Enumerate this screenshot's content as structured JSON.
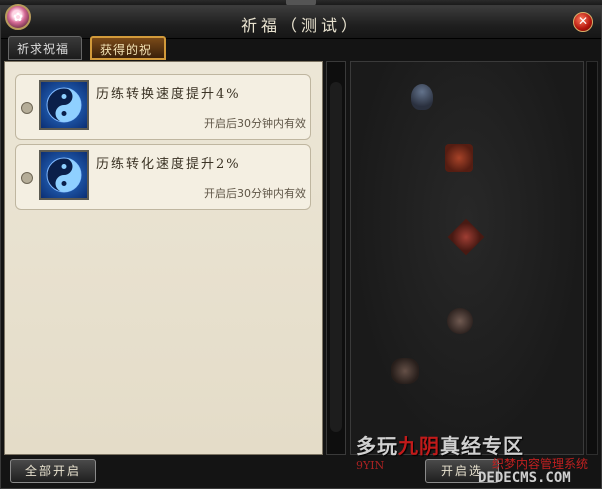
{
  "window": {
    "title": "祈福（测试）",
    "close_glyph": "✕"
  },
  "tabs": [
    {
      "label": "祈求祝福",
      "active": false
    },
    {
      "label": "获得的祝福",
      "active": true
    }
  ],
  "blessings": [
    {
      "name": "历练转换速度提升4%",
      "desc": "开启后30分钟内有效",
      "icon": "taichi-icon"
    },
    {
      "name": "历练转化速度提升2%",
      "desc": "开启后30分钟内有效",
      "icon": "taichi-icon"
    }
  ],
  "buttons": {
    "open_all": "全部开启",
    "open_selected": "开启选"
  },
  "watermark": {
    "site_prefix": "多玩",
    "site_red": "九阴",
    "site_suffix": "真经专区",
    "url_small": "9YIN",
    "site2": "织梦内容管理系统",
    "site2_url": "DEDECMS.COM"
  },
  "colors": {
    "accent_tab": "#d29a3a",
    "panel_bg": "#ece6d6",
    "close_red": "#b3140b"
  }
}
